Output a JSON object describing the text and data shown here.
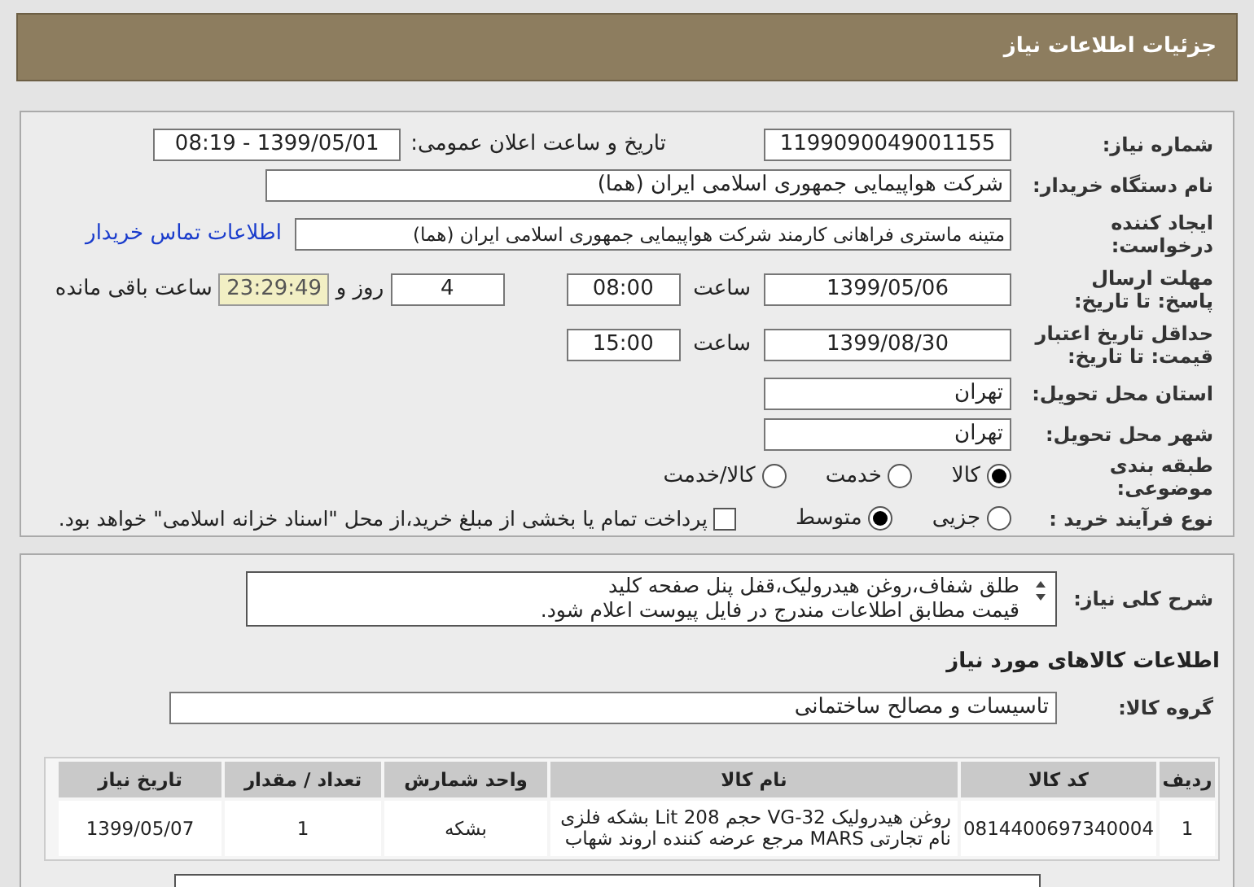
{
  "title": "جزئیات اطلاعات نیاز",
  "need_number": {
    "label": "شماره نیاز:",
    "value": "1199090049001155"
  },
  "announce": {
    "label": "تاریخ و ساعت اعلان عمومی:",
    "value": "1399/05/01 - 08:19"
  },
  "buyer": {
    "label": "نام دستگاه خریدار:",
    "value": "شرکت هواپیمایی جمهوری اسلامی ایران (هما)"
  },
  "requester": {
    "label": "ایجاد کننده درخواست:",
    "value": "متینه ماستری فراهانی کارمند شرکت هواپیمایی جمهوری اسلامی ایران (هما)",
    "link": "اطلاعات تماس خریدار"
  },
  "deadline": {
    "label": "مهلت ارسال پاسخ: تا تاریخ:",
    "date": "1399/05/06",
    "time_label": "ساعت",
    "time": "08:00",
    "days": "4",
    "days_label": "روز و",
    "remaining": "23:29:49",
    "remaining_label": "ساعت باقی مانده"
  },
  "validity": {
    "label": "حداقل تاریخ اعتبار قیمت: تا تاریخ:",
    "date": "1399/08/30",
    "time_label": "ساعت",
    "time": "15:00"
  },
  "province": {
    "label": "استان محل تحویل:",
    "value": "تهران"
  },
  "city": {
    "label": "شهر محل تحویل:",
    "value": "تهران"
  },
  "category": {
    "label": "طبقه بندی موضوعی:",
    "options": [
      {
        "label": "کالا",
        "selected": true
      },
      {
        "label": "خدمت",
        "selected": false
      },
      {
        "label": "کالا/خدمت",
        "selected": false
      }
    ]
  },
  "process": {
    "label": "نوع فرآیند خرید :",
    "options": [
      {
        "label": "جزیی",
        "selected": false
      },
      {
        "label": "متوسط",
        "selected": true
      }
    ],
    "payment": {
      "checked": false,
      "label": "پرداخت تمام یا بخشی از مبلغ خرید،از محل \"اسناد خزانه اسلامی\" خواهد بود."
    }
  },
  "description": {
    "label": "شرح کلی نیاز:",
    "lines": [
      "طلق شفاف،روغن هیدرولیک،قفل پنل صفحه کلید",
      "قیمت مطابق اطلاعات مندرج در فایل پیوست اعلام شود."
    ]
  },
  "goods_title": "اطلاعات کالاهای مورد نیاز",
  "goods_group": {
    "label": "گروه کالا:",
    "value": "تاسیسات و مصالح ساختمانی"
  },
  "table": {
    "columns": [
      "ردیف",
      "کد کالا",
      "نام کالا",
      "واحد شمارش",
      "تعداد / مقدار",
      "تاریخ نیاز"
    ],
    "rows": [
      [
        "1",
        "0814400697340004",
        "روغن هیدرولیک VG-32 حجم Lit 208 بشکه فلزی نام تجارتی MARS مرجع عرضه کننده اروند شهاب",
        "بشکه",
        "1",
        "1399/05/07"
      ]
    ]
  }
}
